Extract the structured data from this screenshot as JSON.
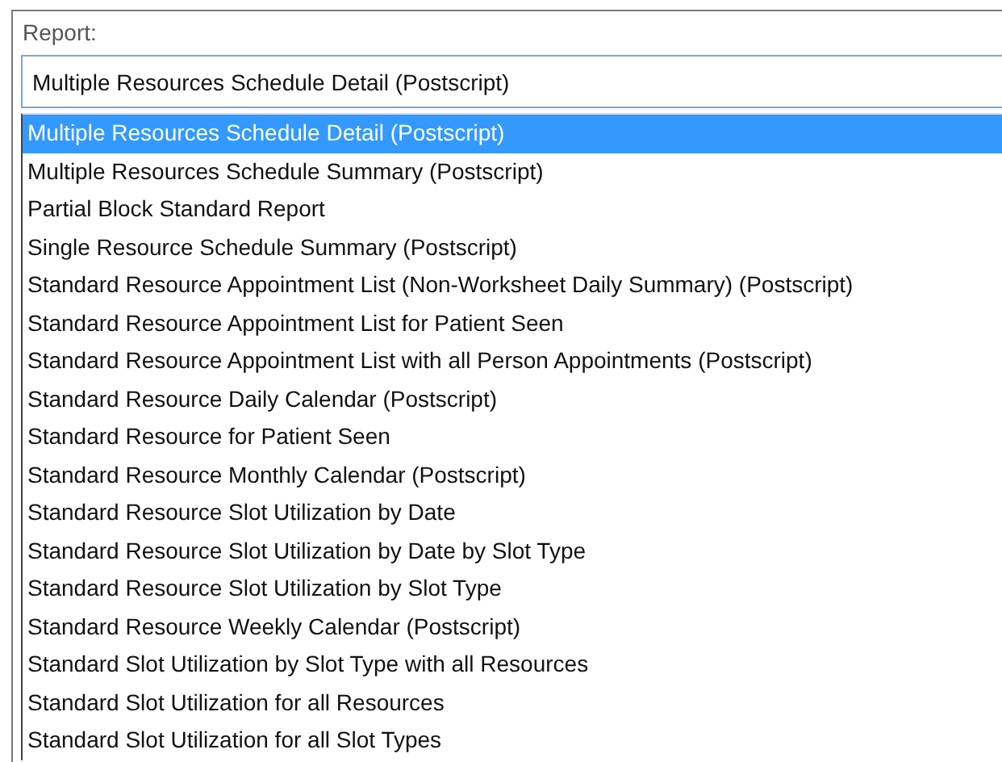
{
  "label": "Report:",
  "field": {
    "value": "Multiple Resources Schedule Detail (Postscript)"
  },
  "options": [
    {
      "label": "Multiple Resources Schedule Detail (Postscript)",
      "selected": true
    },
    {
      "label": "Multiple Resources Schedule Summary (Postscript)",
      "selected": false
    },
    {
      "label": "Partial Block Standard Report",
      "selected": false
    },
    {
      "label": "Single Resource Schedule Summary (Postscript)",
      "selected": false
    },
    {
      "label": "Standard Resource Appointment List (Non-Worksheet Daily Summary) (Postscript)",
      "selected": false
    },
    {
      "label": "Standard Resource Appointment List for Patient Seen",
      "selected": false
    },
    {
      "label": "Standard Resource Appointment List with all Person Appointments (Postscript)",
      "selected": false
    },
    {
      "label": "Standard Resource Daily Calendar (Postscript)",
      "selected": false
    },
    {
      "label": "Standard Resource for Patient Seen",
      "selected": false
    },
    {
      "label": "Standard Resource Monthly Calendar (Postscript)",
      "selected": false
    },
    {
      "label": "Standard Resource Slot Utilization by Date",
      "selected": false
    },
    {
      "label": "Standard Resource Slot Utilization by Date by Slot Type",
      "selected": false
    },
    {
      "label": "Standard Resource Slot Utilization by Slot Type",
      "selected": false
    },
    {
      "label": "Standard Resource Weekly Calendar (Postscript)",
      "selected": false
    },
    {
      "label": "Standard Slot Utilization by Slot Type with all Resources",
      "selected": false
    },
    {
      "label": "Standard Slot Utilization for all Resources",
      "selected": false
    },
    {
      "label": "Standard Slot Utilization for all Slot Types",
      "selected": false
    }
  ]
}
